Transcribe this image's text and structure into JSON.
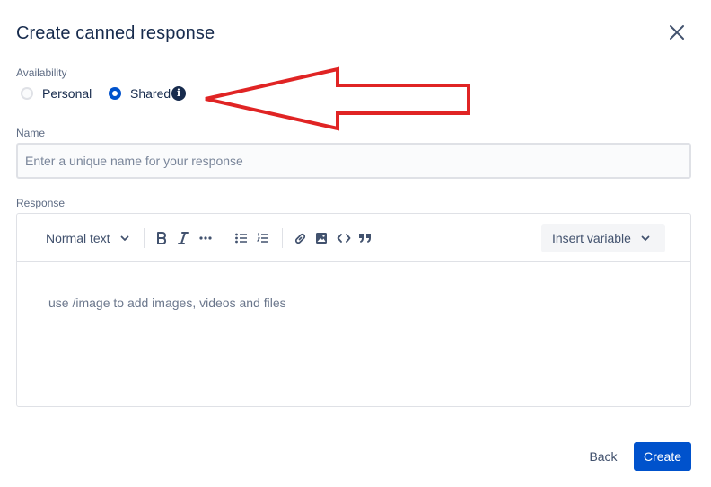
{
  "dialog": {
    "title": "Create canned response"
  },
  "availability": {
    "label": "Availability",
    "options": [
      {
        "label": "Personal",
        "selected": false
      },
      {
        "label": "Shared",
        "selected": true
      }
    ],
    "info_icon": "info-icon"
  },
  "name": {
    "label": "Name",
    "value": "",
    "placeholder": "Enter a unique name for your response"
  },
  "response": {
    "label": "Response",
    "toolbar": {
      "text_style": "Normal text",
      "insert_variable": "Insert variable",
      "icons": [
        "bold-icon",
        "italic-icon",
        "more-formatting-icon",
        "bullet-list-icon",
        "numbered-list-icon",
        "link-icon",
        "image-icon",
        "code-icon",
        "quote-icon"
      ]
    },
    "placeholder": "use /image to add images, videos and files"
  },
  "footer": {
    "back_label": "Back",
    "create_label": "Create"
  },
  "colors": {
    "primary": "#0052cc",
    "text": "#172b4d",
    "annotation_arrow": "#e02424"
  }
}
